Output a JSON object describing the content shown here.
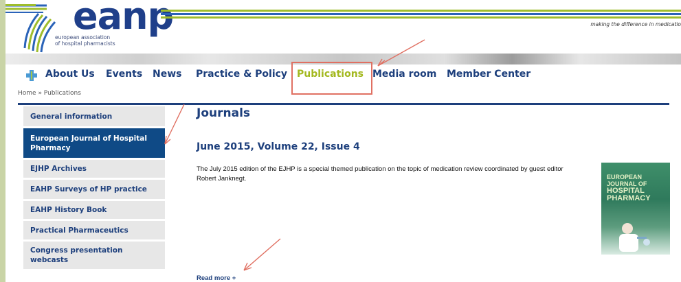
{
  "header": {
    "logo_text": "eanp",
    "logo_sub_line1": "european association",
    "logo_sub_line2": "of hospital pharmacists",
    "tagline": "making the difference in medicatio"
  },
  "nav": {
    "items": [
      {
        "label": "About Us"
      },
      {
        "label": "Events"
      },
      {
        "label": "News"
      },
      {
        "label": "Practice & Policy"
      },
      {
        "label": "Publications"
      },
      {
        "label": "Media room"
      },
      {
        "label": "Member Center"
      }
    ]
  },
  "breadcrumb": "Home » Publications",
  "sidebar": {
    "items": [
      {
        "label": "General information"
      },
      {
        "label": "European Journal of Hospital Pharmacy"
      },
      {
        "label": "EJHP Archives"
      },
      {
        "label": "EAHP Surveys of HP practice"
      },
      {
        "label": "EAHP History Book"
      },
      {
        "label": "Practical Pharmaceutics"
      },
      {
        "label": "Congress presentation webcasts"
      }
    ]
  },
  "main": {
    "title": "Journals",
    "article_title": "June 2015, Volume 22, Issue 4",
    "article_body": "The July 2015 edition of the EJHP is a special themed publication on the topic of medication review coordinated by guest editor Robert Janknegt.",
    "read_more": "Read more +"
  },
  "cover": {
    "line1": "EUROPEAN",
    "line2": "JOURNAL OF",
    "line3": "HOSPITAL",
    "line4": "PHARMACY"
  },
  "colors": {
    "navy": "#1d3f7c",
    "active_nav": "#a3b81e",
    "sidebar_active": "#0f4a86",
    "annotation": "#e07062"
  }
}
